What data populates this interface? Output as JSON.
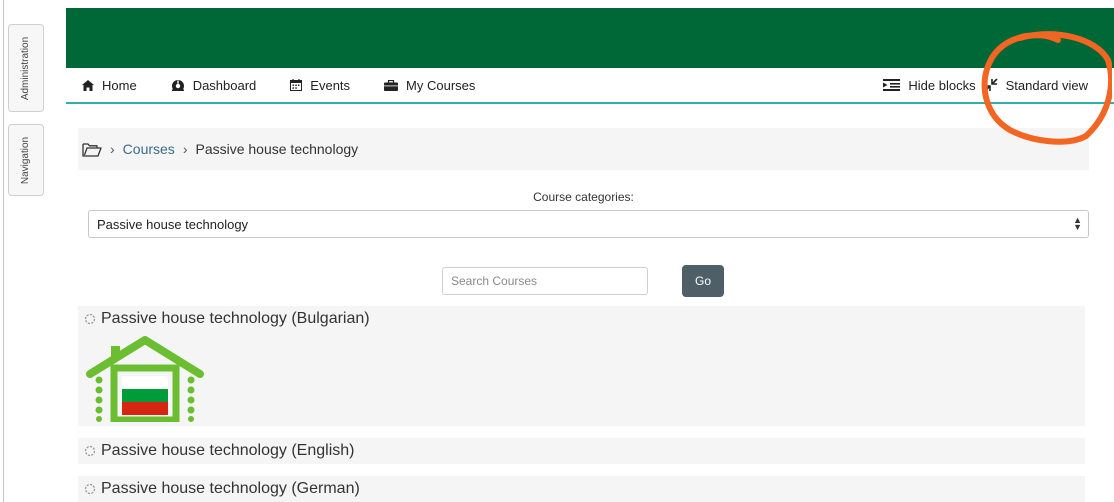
{
  "side_tabs": {
    "administration": "Administration",
    "navigation": "Navigation"
  },
  "nav": {
    "home": "Home",
    "dashboard": "Dashboard",
    "events": "Events",
    "my_courses": "My Courses",
    "hide_blocks": "Hide blocks",
    "standard_view": "Standard view"
  },
  "breadcrumb": {
    "courses": "Courses",
    "current": "Passive house technology"
  },
  "category": {
    "label": "Course categories:",
    "selected": "Passive house technology"
  },
  "search": {
    "placeholder": "Search Courses",
    "go_label": "Go"
  },
  "courses": [
    {
      "title": "Passive house technology (Bulgarian)"
    },
    {
      "title": "Passive house technology (English)"
    },
    {
      "title": "Passive house technology (German)"
    }
  ],
  "colors": {
    "header": "#006837",
    "accent": "#2fb1a9",
    "go_button": "#4f5f68",
    "annotation": "#f26522"
  },
  "icons": [
    "home-icon",
    "dashboard-icon",
    "calendar-icon",
    "briefcase-icon",
    "hide-blocks-icon",
    "collapse-icon",
    "folder-icon",
    "expand-icon"
  ]
}
